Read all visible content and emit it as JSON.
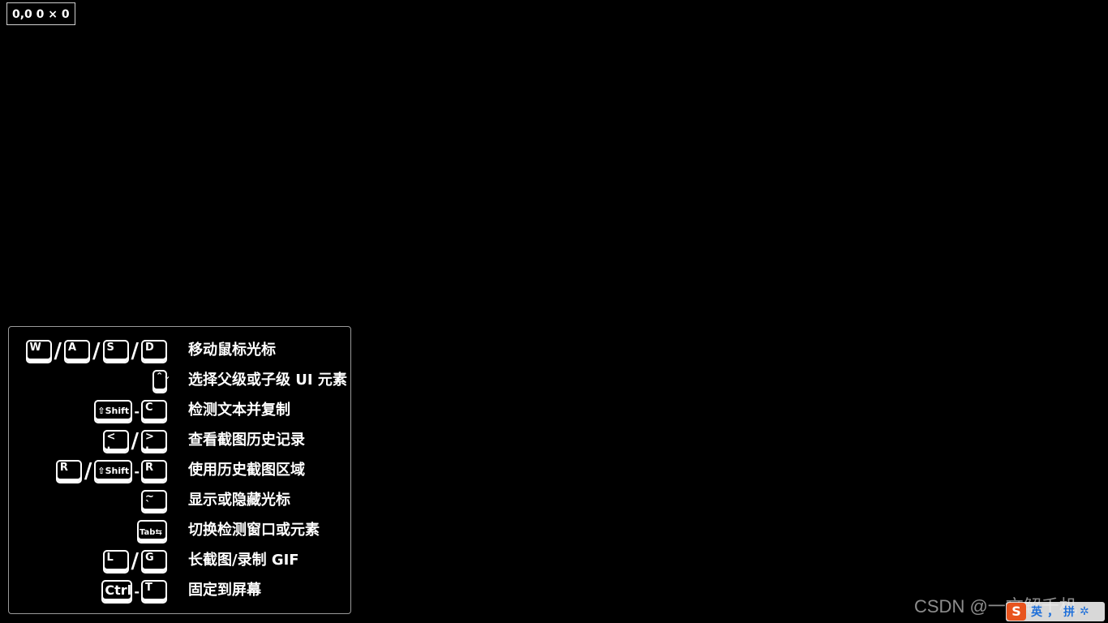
{
  "readout": {
    "text": "0,0  0 × 0"
  },
  "shortcuts": [
    {
      "keys": [
        {
          "t": "key",
          "label": "W"
        },
        {
          "t": "sep",
          "label": "/"
        },
        {
          "t": "key",
          "label": "A"
        },
        {
          "t": "sep",
          "label": "/"
        },
        {
          "t": "key",
          "label": "S"
        },
        {
          "t": "sep",
          "label": "/"
        },
        {
          "t": "key",
          "label": "D"
        }
      ],
      "desc": "移动鼠标光标"
    },
    {
      "keys": [
        {
          "t": "key",
          "label": "⌃⌄",
          "k": "arrows"
        }
      ],
      "desc": "选择父级或子级 UI 元素"
    },
    {
      "keys": [
        {
          "t": "key",
          "label": "⇧Shift",
          "k": "wide"
        },
        {
          "t": "dash",
          "label": "-"
        },
        {
          "t": "key",
          "label": "C"
        }
      ],
      "desc": "检测文本并复制"
    },
    {
      "keys": [
        {
          "t": "key",
          "label": "<\n,"
        },
        {
          "t": "sep",
          "label": "/"
        },
        {
          "t": "key",
          "label": ">\n."
        }
      ],
      "desc": "查看截图历史记录"
    },
    {
      "keys": [
        {
          "t": "key",
          "label": "R"
        },
        {
          "t": "sep",
          "label": "/"
        },
        {
          "t": "key",
          "label": "⇧Shift",
          "k": "wide"
        },
        {
          "t": "dash",
          "label": "-"
        },
        {
          "t": "key",
          "label": "R"
        }
      ],
      "desc": "使用历史截图区域"
    },
    {
      "keys": [
        {
          "t": "key",
          "label": "~\n`"
        }
      ],
      "desc": "显示或隐藏光标"
    },
    {
      "keys": [
        {
          "t": "key",
          "label": "Tab⇆",
          "k": "tab"
        }
      ],
      "desc": "切换检测窗口或元素"
    },
    {
      "keys": [
        {
          "t": "key",
          "label": "L"
        },
        {
          "t": "sep",
          "label": "/"
        },
        {
          "t": "key",
          "label": "G"
        }
      ],
      "desc": "长截图/录制 GIF"
    },
    {
      "keys": [
        {
          "t": "key",
          "label": "Ctrl",
          "k": "ctrl"
        },
        {
          "t": "dash",
          "label": "-"
        },
        {
          "t": "key",
          "label": "T"
        }
      ],
      "desc": "固定到屏幕"
    }
  ],
  "watermark": {
    "text": "CSDN @一文解千机"
  },
  "ime": {
    "logo": "S",
    "items": [
      "英",
      "，",
      "拼",
      "✲"
    ]
  }
}
